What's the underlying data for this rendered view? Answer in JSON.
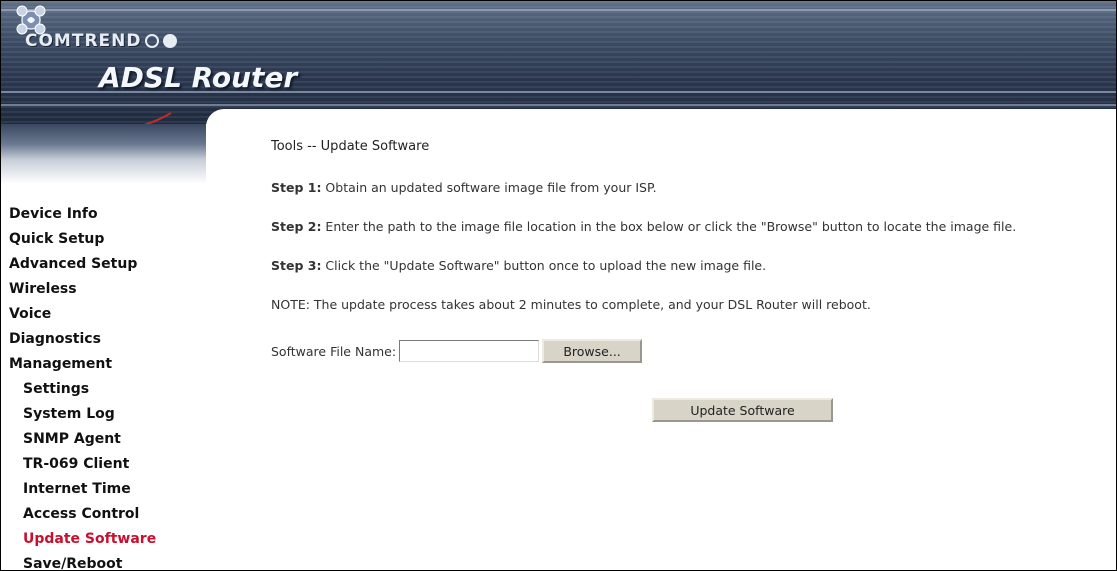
{
  "header": {
    "brand": "COMTREND",
    "product": "ADSL Router"
  },
  "sidebar": {
    "items": [
      {
        "label": "Device Info"
      },
      {
        "label": "Quick Setup"
      },
      {
        "label": "Advanced Setup"
      },
      {
        "label": "Wireless"
      },
      {
        "label": "Voice"
      },
      {
        "label": "Diagnostics"
      },
      {
        "label": "Management"
      },
      {
        "label": "Settings"
      },
      {
        "label": "System Log"
      },
      {
        "label": "SNMP Agent"
      },
      {
        "label": "TR-069 Client"
      },
      {
        "label": "Internet Time"
      },
      {
        "label": "Access Control"
      },
      {
        "label": "Update Software",
        "active": true
      },
      {
        "label": "Save/Reboot"
      }
    ]
  },
  "main": {
    "title": "Tools -- Update Software",
    "step1_label": "Step 1:",
    "step1_text": " Obtain an updated software image file from your ISP.",
    "step2_label": "Step 2:",
    "step2_text": " Enter the path to the image file location in the box below or click the \"Browse\" button to locate the image file.",
    "step3_label": "Step 3:",
    "step3_text": " Click the \"Update Software\" button once to upload the new image file.",
    "note": "NOTE: The update process takes about 2 minutes to complete, and your DSL Router will reboot.",
    "file_label": "Software File Name:",
    "file_value": "",
    "browse_label": "Browse...",
    "update_label": "Update Software"
  },
  "colors": {
    "active_nav": "#c8102e",
    "banner_dark": "#1f2a3e",
    "button_face": "#d8d4c8"
  }
}
